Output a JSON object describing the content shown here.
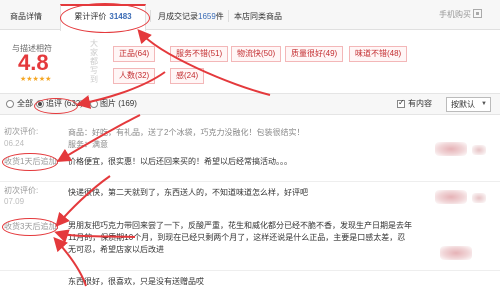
{
  "tabs": {
    "product_details": "商品详情",
    "cumulative_reviews": "累计评价",
    "cumulative_reviews_count": "31483",
    "monthly_sales_label": "月成交记录",
    "monthly_sales_count": "1659",
    "monthly_sales_unit": "件",
    "similar_products": "本店同类商品",
    "mobile_buy": "手机购买"
  },
  "rating": {
    "title": "与描述相符",
    "score": "4.8",
    "stars": "★★★★★",
    "faint_text": "大家都写到",
    "tags": [
      {
        "label": "正品(64)"
      },
      {
        "label": "服务不错(51)"
      },
      {
        "label": "物流快(50)"
      },
      {
        "label": "质量很好(49)"
      },
      {
        "label": "味道不错(48)"
      },
      {
        "label": "人数(32)"
      },
      {
        "label": "感(24)"
      }
    ]
  },
  "filter": {
    "all": "全部",
    "followup": "追评 (632)",
    "images": "图片 (169)",
    "has_content": "有内容",
    "sort": "按默认"
  },
  "reviews": [
    {
      "label": "初次评价:",
      "date": "06.24",
      "product_line": "商品：好吃，有礼品，送了2个冰袋，巧克力没融化！包装很结实！",
      "service_line": "服务：满意",
      "followup_label": "收货1天后追加:",
      "followup_text": "价格便宜，很实惠！以后还回来买的！希望以后经常搞活动。。。"
    },
    {
      "label": "初次评价:",
      "date": "07.09",
      "text": "快递很快，第二天就到了，东西送人的，不知道味道怎么样，好评吧",
      "followup_label": "收货3天后追加:",
      "followup_text": "男朋友把巧克力带回来尝了一下，反酸严重，花生和威化都分已经不脆不香，发现生产日期是去年11月的，保质期10个月，到现在已经只剩两个月了，这样还说是什么正品，主要是口感太差，忍无可忍，希望店家以后改进"
    },
    {
      "partial_text": "东西很好，很喜欢，只是没有送赠品哎"
    }
  ],
  "colors": {
    "accent_red": "#e4393c",
    "link_blue": "#3a6bb5",
    "star_gold": "#f5a623"
  }
}
